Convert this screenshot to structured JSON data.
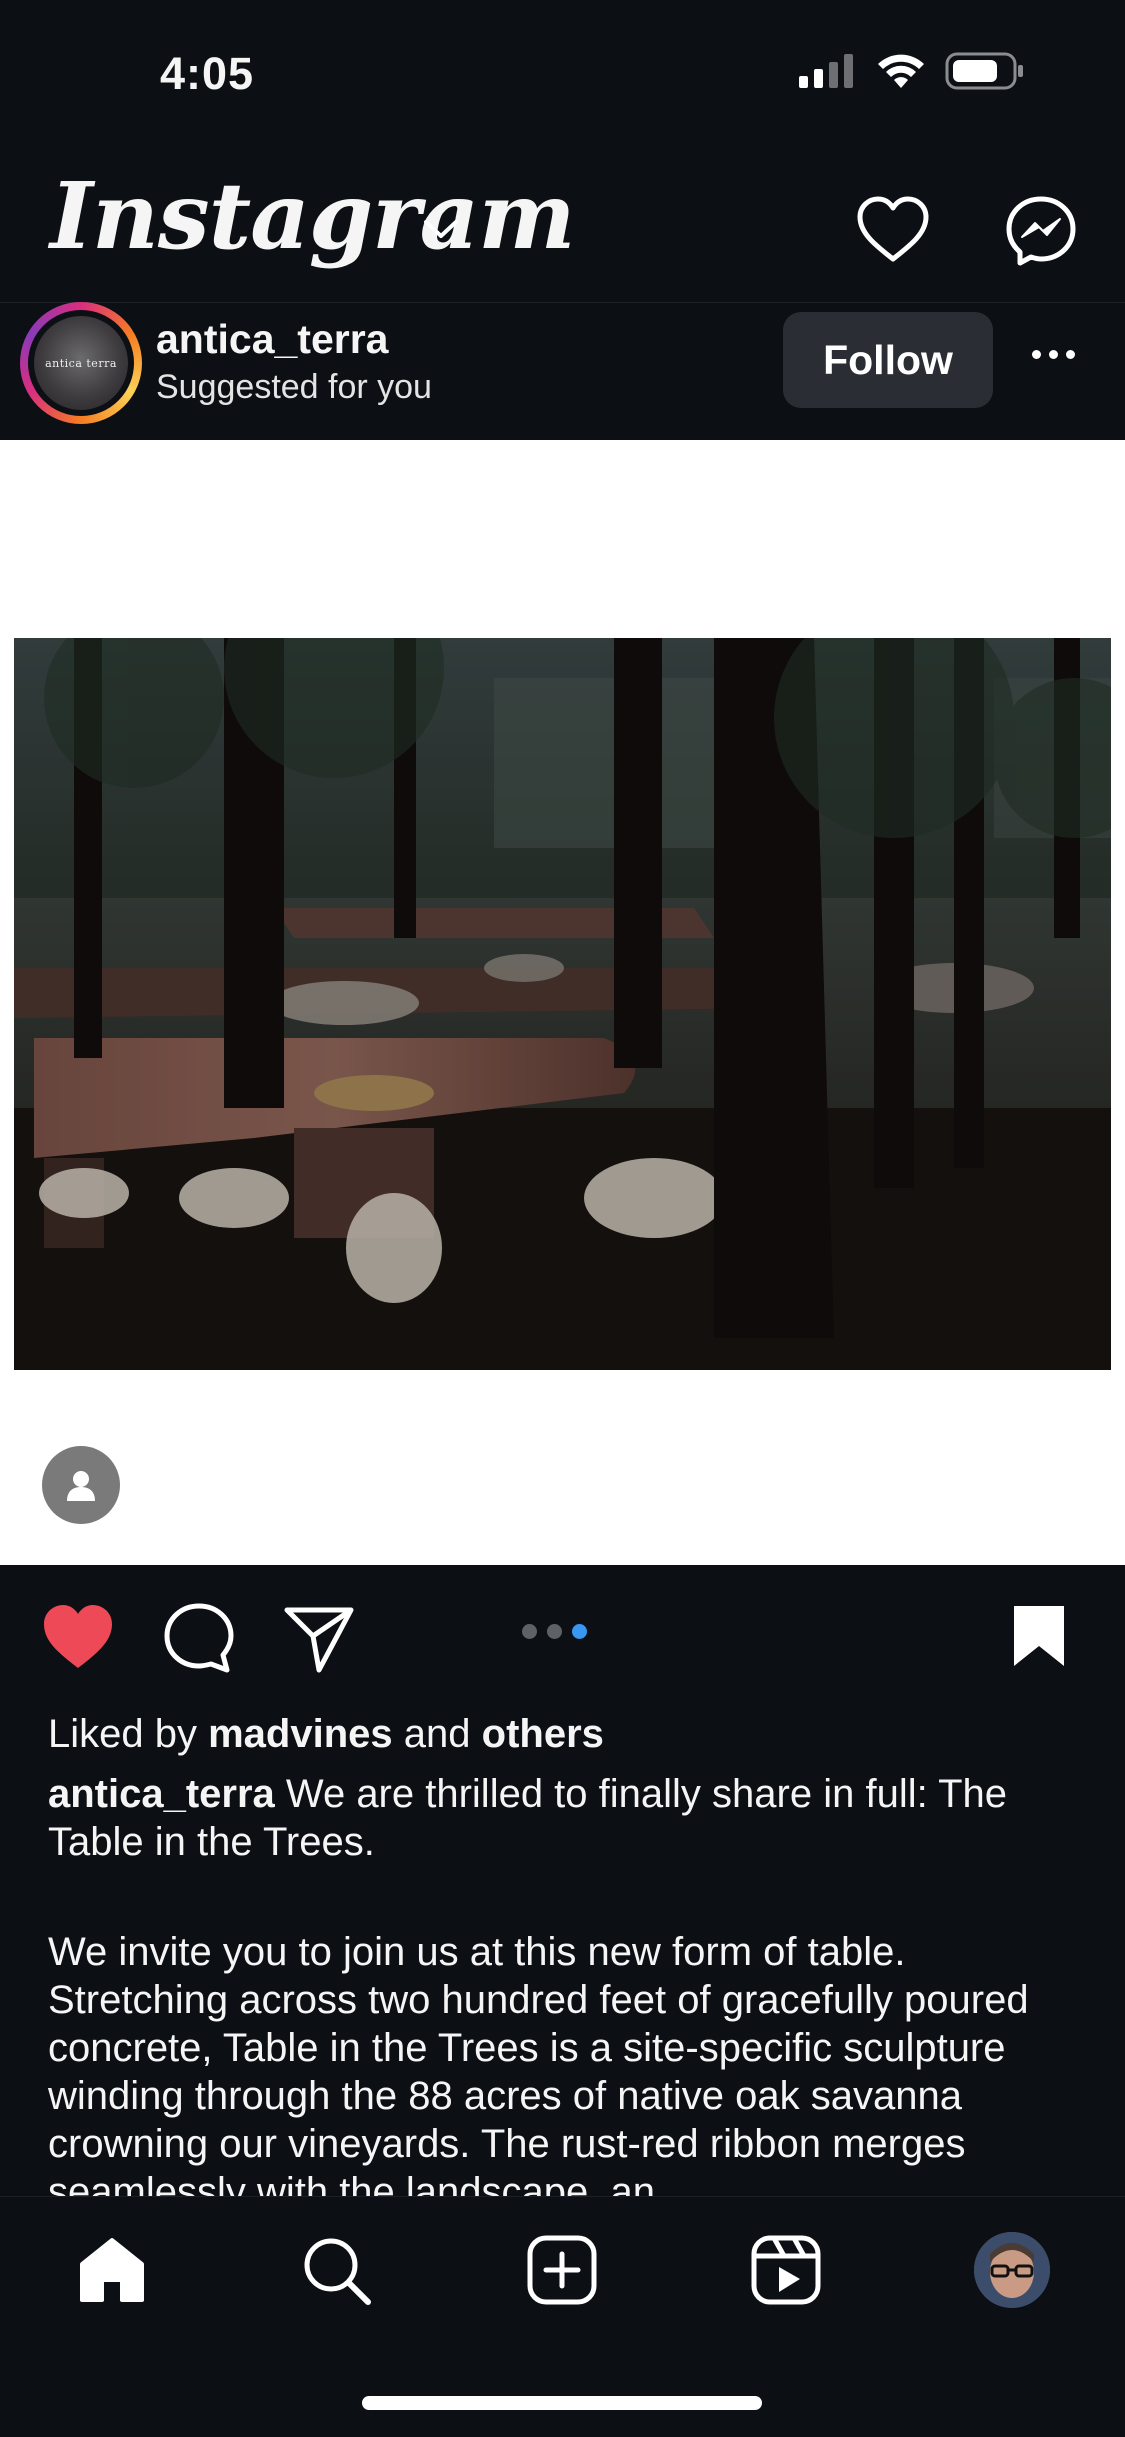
{
  "status_bar": {
    "time": "4:05",
    "icons": [
      "cellular-signal-icon",
      "wifi-icon",
      "battery-icon"
    ]
  },
  "header": {
    "logo_text": "Instagram",
    "icons": [
      "chevron-down-icon",
      "heart-icon",
      "messenger-icon"
    ]
  },
  "post": {
    "username": "antica_terra",
    "subtitle": "Suggested for you",
    "avatar_text": "antica terra",
    "follow_label": "Follow",
    "carousel": {
      "count": 3,
      "active_index": 2
    },
    "liked_prefix": "Liked by",
    "liked_user": "madvines",
    "liked_and": "and",
    "liked_others": "others",
    "caption_user": "antica_terra",
    "caption_first": "We are thrilled to finally share in full: The Table in the Trees.",
    "caption_body": "We invite you to join us at this new form of table. Stretching across two hundred feet of gracefully poured concrete, Table in the Trees is a site-specific sculpture winding through the 88 acres of native oak savanna crowning our vineyards. The rust-red ribbon merges seamlessly with the landscape, an"
  },
  "nav": {
    "items": [
      "home-icon",
      "search-icon",
      "create-icon",
      "reels-icon",
      "profile-avatar"
    ]
  },
  "colors": {
    "background": "#0c0f14",
    "like_red": "#ed4956",
    "carousel_active": "#3897f0",
    "follow_button": "#2a2d33"
  }
}
